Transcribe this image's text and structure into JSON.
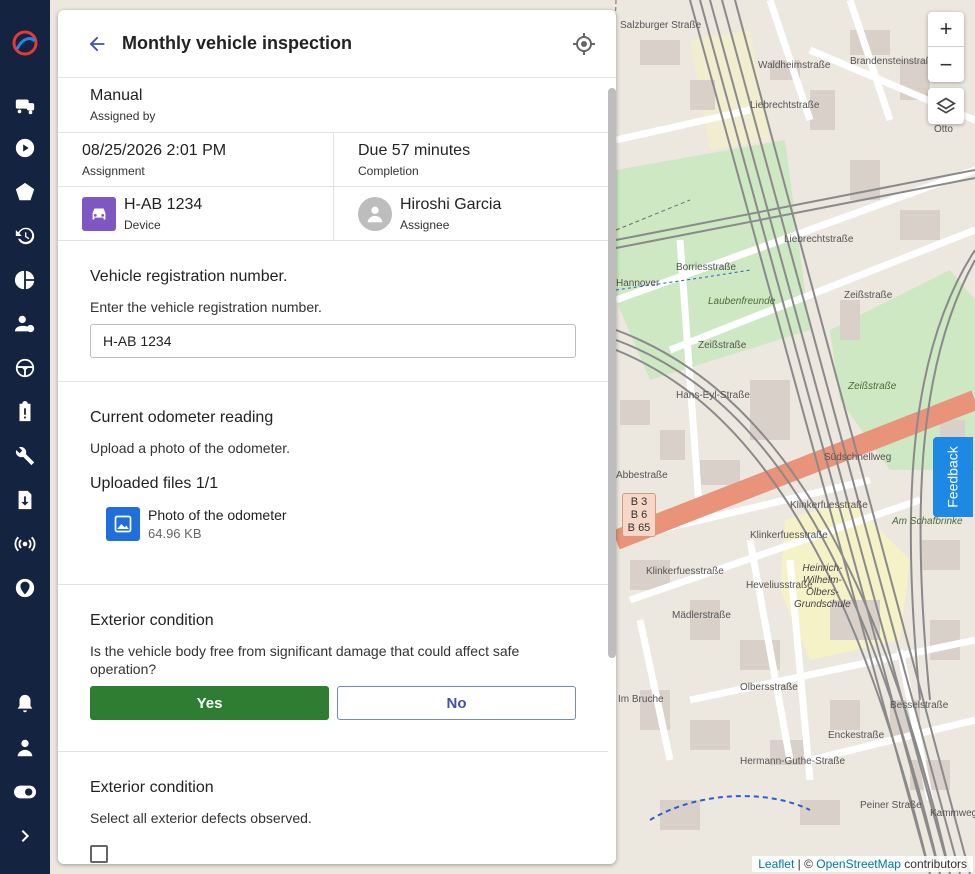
{
  "header": {
    "title": "Monthly vehicle inspection"
  },
  "assigned_by": {
    "value": "Manual",
    "label": "Assigned by"
  },
  "assignment": {
    "value": "08/25/2026 2:01 PM",
    "label": "Assignment"
  },
  "completion": {
    "value": "Due 57 minutes",
    "label": "Completion"
  },
  "device": {
    "value": "H-AB 1234",
    "label": "Device"
  },
  "assignee": {
    "value": "Hiroshi Garcia",
    "label": "Assignee"
  },
  "q1": {
    "title": "Vehicle registration number.",
    "description": "Enter the vehicle registration number.",
    "input_value": "H-AB 1234"
  },
  "q2": {
    "title": "Current odometer reading",
    "description": "Upload a photo of the odometer.",
    "uploaded_label": "Uploaded files 1/1",
    "file_name": "Photo of the odometer",
    "file_size": "64.96 KB"
  },
  "q3": {
    "title": "Exterior condition",
    "description": "Is the vehicle body free from significant damage that could affect safe operation?",
    "yes_label": "Yes",
    "no_label": "No"
  },
  "q4": {
    "title": "Exterior condition",
    "description": "Select all exterior defects observed."
  },
  "map": {
    "zoom_in": "+",
    "zoom_out": "−",
    "feedback": "Feedback",
    "attribution_leaflet": "Leaflet",
    "attribution_sep": " | © ",
    "attribution_osm": "OpenStreetMap",
    "attribution_tail": " contributors",
    "shield": [
      "B 3",
      "B 6",
      "B 65"
    ],
    "labels": {
      "liebrecht": "Liebrechtstraße",
      "laubenfreunde": "Laubenfreunde",
      "zeiss1": "Zeißstraße",
      "zeiss2": "Zeißstraße",
      "zeiss3": "Zeißstraße",
      "hannover": "Hannover",
      "hanseyl": "Hans-Eyl-Straße",
      "abbe": "Abbestraße",
      "suedschnellweg": "Südschnellweg",
      "schafbrinke": "Am Schafbrinke",
      "klinker1": "Klinkerfuesstraße",
      "klinker2": "Klinkerfuesstraße",
      "klinker3": "Klinkerfuesstraße",
      "school": "Heinrich-\nWilhelm-\nOlbers-\nGrundschule",
      "olbers": "Olbersstraße",
      "encke": "Enckestraße",
      "peiner": "Peiner Straße",
      "waldheim": "Waldheimstraße",
      "borries": "Borriesstraße",
      "maedler": "Mädlerstraße",
      "hevellius": "Heveliusstraße",
      "imbruche": "Im Bruche",
      "hermann": "Hermann-Guthe-Straße",
      "bessel": "Besselstraße",
      "kammweg": "Kammweg",
      "salzburger": "Salzburger Straße",
      "brandenstein": "Brandensteinstraße",
      "liebrecht2": "Liebrechtstraße",
      "otto": "Otto"
    }
  },
  "colors": {
    "rail": "#14233f",
    "yes": "#2e7d32",
    "accent": "#1e6fd9",
    "device": "#7e57c2"
  }
}
